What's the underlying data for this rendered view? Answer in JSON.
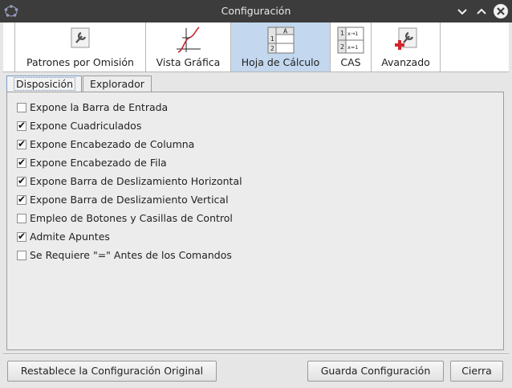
{
  "window": {
    "title": "Configuración"
  },
  "toolbar": {
    "tabs": [
      {
        "label": "Patrones por Omisión",
        "icon": "wrench-icon"
      },
      {
        "label": "Vista Gráfica",
        "icon": "graph-icon"
      },
      {
        "label": "Hoja de Cálculo",
        "icon": "spreadsheet-icon",
        "active": true
      },
      {
        "label": "CAS",
        "icon": "cas-icon"
      },
      {
        "label": "Avanzado",
        "icon": "advanced-wrench-icon"
      }
    ],
    "active_color": "#c3d7ee"
  },
  "subtabs": [
    {
      "label": "Disposición",
      "active": true
    },
    {
      "label": "Explorador"
    }
  ],
  "options": [
    {
      "label": "Expone la Barra de Entrada",
      "checked": false
    },
    {
      "label": "Expone Cuadriculados",
      "checked": true
    },
    {
      "label": "Expone Encabezado de Columna",
      "checked": true
    },
    {
      "label": "Expone Encabezado de Fila",
      "checked": true
    },
    {
      "label": "Expone Barra de Deslizamiento Horizontal",
      "checked": true
    },
    {
      "label": "Expone Barra de Deslizamiento Vertical",
      "checked": true
    },
    {
      "label": "Empleo de Botones y Casillas de Control",
      "checked": false
    },
    {
      "label": "Admite Apuntes",
      "checked": true
    },
    {
      "label": "Se Requiere \"=\" Antes de los Comandos",
      "checked": false
    }
  ],
  "buttons": {
    "reset": "Restablece la Configuración Original",
    "save": "Guarda Configuración",
    "close": "Cierra"
  },
  "icons": {
    "cas_lines": [
      "1",
      "x→1",
      "2",
      "x=1"
    ],
    "spreadsheet_header": "A",
    "spreadsheet_rows": [
      "1",
      "2"
    ]
  },
  "check_mark": "✔"
}
